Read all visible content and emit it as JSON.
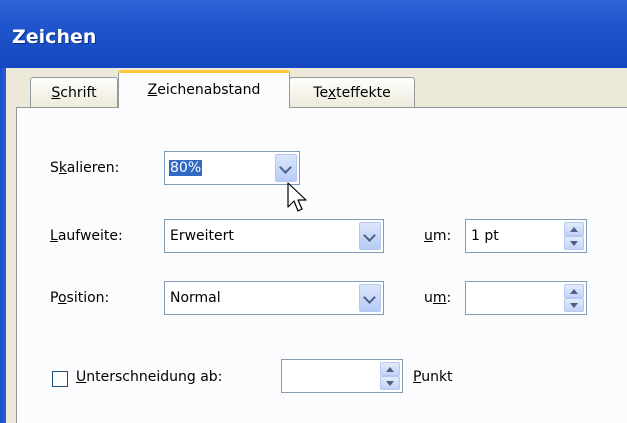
{
  "window": {
    "title": "Zeichen"
  },
  "tabs": [
    {
      "label": "Schrift",
      "mnemonic": "S",
      "rest": "chrift",
      "active": false
    },
    {
      "label": "Zeichenabstand",
      "mnemonic": "Z",
      "rest": "eichenabstand",
      "active": true
    },
    {
      "label": "Texteffekte",
      "pre": "Te",
      "mnemonic": "x",
      "rest": "teffekte",
      "active": false
    }
  ],
  "skalieren": {
    "label_pre": "S",
    "label_mn": "k",
    "label_post": "alieren:",
    "value": "80%"
  },
  "laufweite": {
    "label_mn": "L",
    "label_post": "aufweite:",
    "value": "Erweitert",
    "um_mn": "u",
    "um_post": "m:",
    "um_value": "1 pt"
  },
  "position": {
    "label_pre": "P",
    "label_mn": "o",
    "label_post": "sition:",
    "value": "Normal",
    "um_pre": "u",
    "um_mn": "m",
    "um_post": ":",
    "um_value": ""
  },
  "kerning": {
    "label_mn": "U",
    "label_post": "nterschneidung ab:",
    "checked": false,
    "value": "",
    "unit_mn": "P",
    "unit_post": "unkt"
  },
  "icons": [
    "dropdown-arrow-icon",
    "spin-up-icon",
    "spin-down-icon",
    "mouse-pointer-icon"
  ],
  "colors": {
    "titlebar": "#2158d0",
    "selection": "#316ac5",
    "tab_highlight": "#ffc83c",
    "dialog": "#ece9d8"
  }
}
